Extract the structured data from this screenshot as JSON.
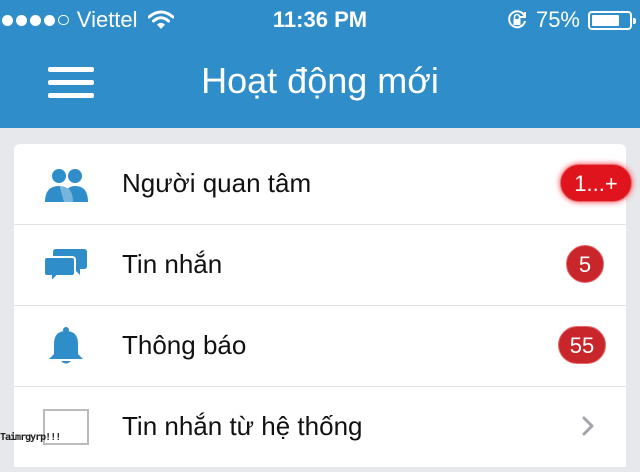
{
  "status_bar": {
    "carrier": "Viettel",
    "time": "11:36 PM",
    "battery": "75%",
    "battery_level": 0.75,
    "signal_bars": 4,
    "signal_max": 5
  },
  "header": {
    "title": "Hoạt động mới",
    "menu_icon": "hamburger-menu-icon"
  },
  "list": {
    "items": [
      {
        "label": "Người quan tâm",
        "icon": "people-icon",
        "badge": "1...+"
      },
      {
        "label": "Tin nhắn",
        "icon": "chat-bubbles-icon",
        "badge": "5"
      },
      {
        "label": "Thông báo",
        "icon": "bell-icon",
        "badge": "55"
      },
      {
        "label": "Tin nhắn từ hệ thống",
        "icon": "system-box-icon",
        "badge": ""
      }
    ]
  },
  "watermark": {
    "text": "Taimrgyrp!!!"
  },
  "colors": {
    "header_bg": "#2f8ec9",
    "icon_blue": "#2f8ec9",
    "badge_red": "#c9262c",
    "page_bg": "#e6e8eb"
  }
}
